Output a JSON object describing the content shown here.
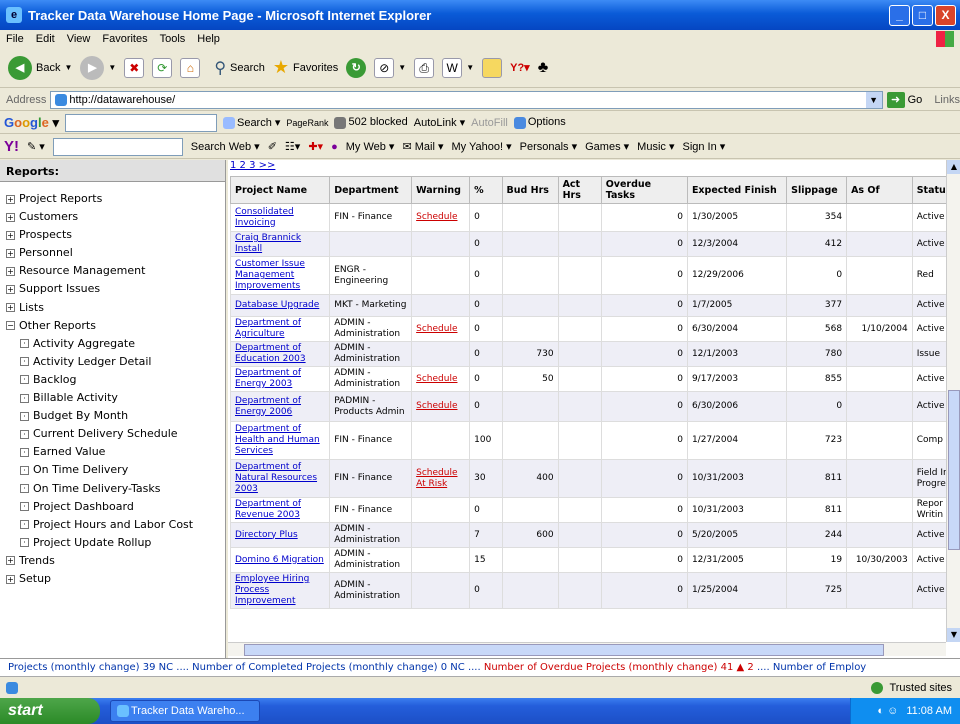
{
  "window": {
    "title": "Tracker Data Warehouse Home Page - Microsoft Internet Explorer",
    "min": "_",
    "max": "□",
    "close": "X"
  },
  "menu": [
    "File",
    "Edit",
    "View",
    "Favorites",
    "Tools",
    "Help"
  ],
  "toolbar": {
    "back": "Back",
    "search": "Search",
    "favorites": "Favorites"
  },
  "address": {
    "label": "Address",
    "url": "http://datawarehouse/",
    "go": "Go",
    "links": "Links"
  },
  "google": {
    "logo": "Google",
    "search": "Search",
    "pagerank": "PageRank",
    "blocked": "502 blocked",
    "autolink": "AutoLink",
    "autofill": "AutoFill",
    "options": "Options"
  },
  "yahoo": {
    "logo": "Y!",
    "search_web": "Search Web",
    "myweb": "My Web",
    "mail": "Mail",
    "myyahoo": "My Yahoo!",
    "personals": "Personals",
    "games": "Games",
    "music": "Music",
    "signin": "Sign In"
  },
  "reports": {
    "header": "Reports:",
    "top": [
      "Project Reports",
      "Customers",
      "Prospects",
      "Personnel",
      "Resource Management",
      "Support Issues",
      "Lists"
    ],
    "other": "Other Reports",
    "other_items": [
      "Activity Aggregate",
      "Activity Ledger Detail",
      "Backlog",
      "Billable Activity",
      "Budget By Month",
      "Current Delivery Schedule",
      "Earned Value",
      "On Time Delivery",
      "On Time Delivery-Tasks",
      "Project Dashboard",
      "Project Hours and Labor Cost",
      "Project Update Rollup"
    ],
    "bottom": [
      "Trends",
      "Setup"
    ]
  },
  "pager": "1 2 3 >>",
  "table": {
    "columns": [
      "Project Name",
      "Department",
      "Warning",
      "%",
      "Bud Hrs",
      "Act Hrs",
      "Overdue Tasks",
      "Expected Finish",
      "Slippage",
      "As Of",
      "Status"
    ],
    "rows": [
      [
        "Consolidated Invoicing",
        "FIN - Finance",
        "Schedule",
        "0",
        "",
        "",
        "0",
        "1/30/2005",
        "354",
        "",
        "Active"
      ],
      [
        "Craig Brannick Install",
        "",
        "",
        "0",
        "",
        "",
        "0",
        "12/3/2004",
        "412",
        "",
        "Active"
      ],
      [
        "Customer Issue Management Improvements",
        "ENGR - Engineering",
        "",
        "0",
        "",
        "",
        "0",
        "12/29/2006",
        "0",
        "",
        "Red"
      ],
      [
        "Database Upgrade",
        "MKT - Marketing",
        "",
        "0",
        "",
        "",
        "0",
        "1/7/2005",
        "377",
        "",
        "Active"
      ],
      [
        "Department of Agriculture",
        "ADMIN - Administration",
        "Schedule",
        "0",
        "",
        "",
        "0",
        "6/30/2004",
        "568",
        "1/10/2004",
        "Active"
      ],
      [
        "Department of Education 2003",
        "ADMIN - Administration",
        "",
        "0",
        "730",
        "",
        "0",
        "12/1/2003",
        "780",
        "",
        "Issue"
      ],
      [
        "Department of Energy 2003",
        "ADMIN - Administration",
        "Schedule",
        "0",
        "50",
        "",
        "0",
        "9/17/2003",
        "855",
        "",
        "Active"
      ],
      [
        "Department of Energy 2006",
        "PADMIN - Products Admin",
        "Schedule",
        "0",
        "",
        "",
        "0",
        "6/30/2006",
        "0",
        "",
        "Active"
      ],
      [
        "Department of Health and Human Services",
        "FIN - Finance",
        "",
        "100",
        "",
        "",
        "0",
        "1/27/2004",
        "723",
        "",
        "Comp"
      ],
      [
        "Department of Natural Resources 2003",
        "FIN - Finance",
        "Schedule At Risk",
        "30",
        "400",
        "",
        "0",
        "10/31/2003",
        "811",
        "",
        "Field In Progre"
      ],
      [
        "Department of Revenue 2003",
        "FIN - Finance",
        "",
        "0",
        "",
        "",
        "0",
        "10/31/2003",
        "811",
        "",
        "Repor Writin"
      ],
      [
        "Directory Plus",
        "ADMIN - Administration",
        "",
        "7",
        "600",
        "",
        "0",
        "5/20/2005",
        "244",
        "",
        "Active"
      ],
      [
        "Domino 6 Migration",
        "ADMIN - Administration",
        "",
        "15",
        "",
        "",
        "0",
        "12/31/2005",
        "19",
        "10/30/2003",
        "Active"
      ],
      [
        "Employee Hiring Process Improvement",
        "ADMIN - Administration",
        "",
        "0",
        "",
        "",
        "0",
        "1/25/2004",
        "725",
        "",
        "Active"
      ]
    ]
  },
  "ticker": {
    "part1": "Projects (monthly change) 39 NC .... Number of Completed Projects (monthly change) 0 NC .... ",
    "part2": "Number of Overdue Projects (monthly change) 41 ▲ 2",
    "part3": " .... Number of Employ"
  },
  "status": {
    "zone": "Trusted sites"
  },
  "taskbar": {
    "start": "start",
    "task": "Tracker Data Wareho...",
    "time": "11:08 AM"
  }
}
